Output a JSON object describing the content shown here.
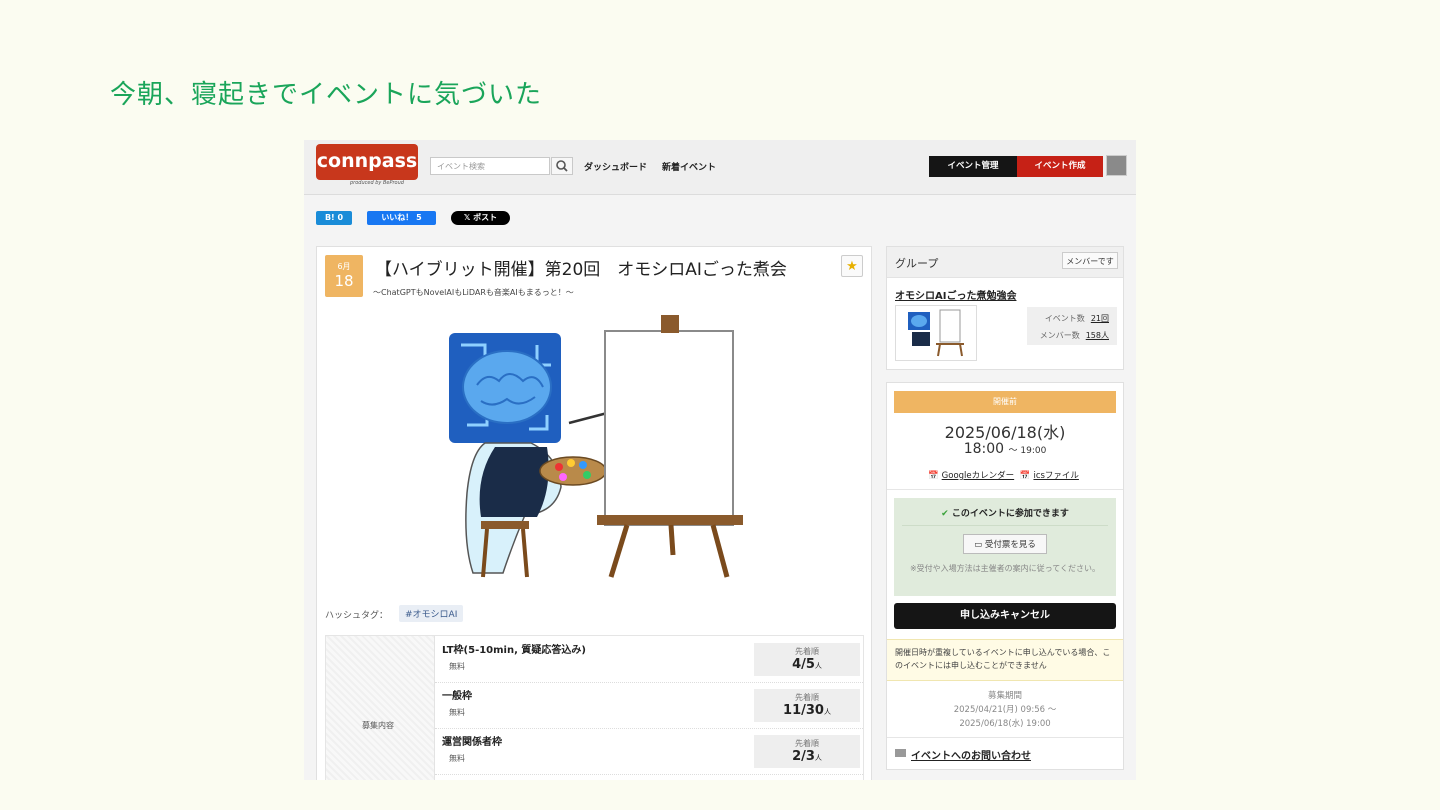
{
  "slide": {
    "title": "今朝、寝起きでイベントに気づいた"
  },
  "header": {
    "logo": "connpass",
    "logo_sub": "produced by BeProud",
    "search_placeholder": "イベント検索",
    "nav": [
      "ダッシュボード",
      "新着イベント"
    ],
    "manage_label": "イベント管理",
    "create_label": "イベント作成"
  },
  "share": {
    "hatena": "B! 0",
    "facebook": "いいね！ 5",
    "x": "𝕏 ポスト"
  },
  "event": {
    "month": "6月",
    "day": "18",
    "title": "【ハイブリット開催】第20回　オモシロAIごった煮会",
    "subtitle": "〜ChatGPTもNovelAIもLiDARも音楽AIもまるっと！〜",
    "hashtag_label": "ハッシュタグ：",
    "hashtag": "#オモシロAI",
    "tickets_label": "募集内容",
    "tickets": [
      {
        "name": "LT枠(5-10min, 質疑応答込み)",
        "fee": "無料",
        "method": "先着順",
        "count": "4/5",
        "unit": "人"
      },
      {
        "name": "一般枠",
        "fee": "無料",
        "method": "先着順",
        "count": "11/30",
        "unit": "人"
      },
      {
        "name": "運営関係者枠",
        "fee": "無料",
        "method": "先着順",
        "count": "2/3",
        "unit": "人"
      }
    ]
  },
  "group": {
    "heading": "グループ",
    "member_button": "メンバーです",
    "name": "オモシロAIごった煮勉強会",
    "events_label": "イベント数",
    "events_value": "21回",
    "members_label": "メンバー数",
    "members_value": "158人"
  },
  "schedule": {
    "status": "開催前",
    "date": "2025/06/18(水)",
    "time_start": "18:00",
    "time_end": "〜 19:00",
    "google_cal": "Googleカレンダー",
    "ics": "icsファイル",
    "join_text": "このイベントに参加できます",
    "ticket_button": "受付票を見る",
    "join_note": "※受付や入場方法は主催者の案内に従ってください。",
    "cancel_button": "申し込みキャンセル",
    "warning": "開催日時が重複しているイベントに申し込んでいる場合、このイベントには申し込むことができません",
    "period_label": "募集期間",
    "period_start": "2025/04/21(月) 09:56 〜",
    "period_end": "2025/06/18(水) 19:00",
    "contact": "イベントへのお問い合わせ"
  },
  "colors": {
    "accent_green": "#1aa55a",
    "brand_red": "#c8371c",
    "status_orange": "#efb562"
  }
}
